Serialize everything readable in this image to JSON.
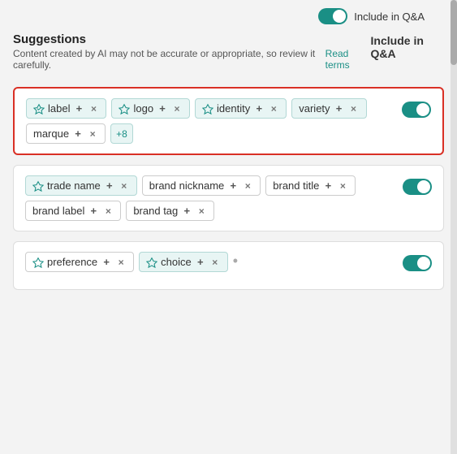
{
  "topBar": {
    "toggleLabel": "Include in Q&A"
  },
  "suggestions": {
    "title": "Suggestions",
    "subtitle": "Content created by AI may not be accurate or appropriate, so review it carefully.",
    "readTermsLabel": "Read terms",
    "includeLabel": "Include in Q&A"
  },
  "cards": [
    {
      "id": "card1",
      "highlighted": true,
      "toggleOn": true,
      "tags": [
        {
          "text": "label",
          "ai": true,
          "plain": false
        },
        {
          "text": "logo",
          "ai": true,
          "plain": false
        },
        {
          "text": "identity",
          "ai": true,
          "plain": false
        },
        {
          "text": "variety",
          "ai": true,
          "plain": false
        },
        {
          "text": "marque",
          "ai": false,
          "plain": true
        }
      ],
      "more": "+8"
    },
    {
      "id": "card2",
      "highlighted": false,
      "toggleOn": true,
      "tags": [
        {
          "text": "trade name",
          "ai": false,
          "plain": false
        },
        {
          "text": "brand nickname",
          "ai": false,
          "plain": false
        },
        {
          "text": "brand title",
          "ai": false,
          "plain": false
        },
        {
          "text": "brand label",
          "ai": false,
          "plain": false
        },
        {
          "text": "brand tag",
          "ai": false,
          "plain": false
        }
      ],
      "more": null
    },
    {
      "id": "card3",
      "highlighted": false,
      "toggleOn": true,
      "tags": [
        {
          "text": "preference",
          "ai": false,
          "plain": false
        },
        {
          "text": "choice",
          "ai": true,
          "plain": false
        }
      ],
      "more": null,
      "partial": true
    }
  ]
}
